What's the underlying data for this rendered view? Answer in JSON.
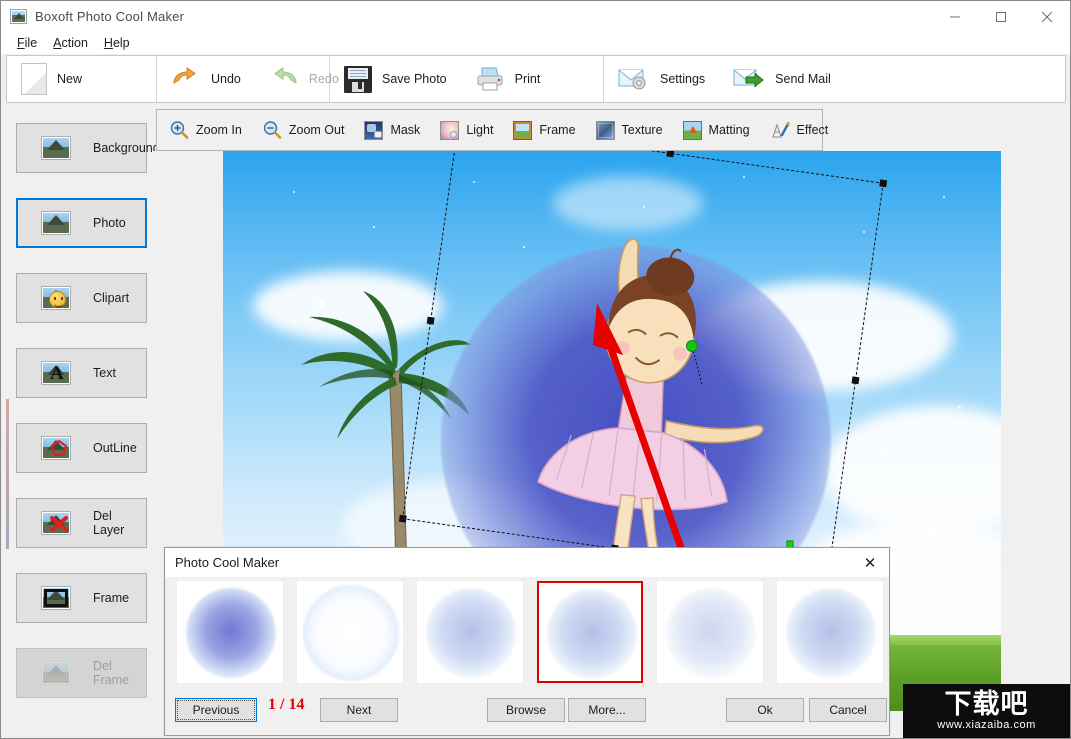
{
  "window": {
    "title": "Boxoft Photo Cool Maker",
    "icon": "app-photo-icon",
    "controls": {
      "minimize": "—",
      "maximize": "□",
      "close": "✕"
    }
  },
  "menubar": {
    "items": [
      {
        "label": "File",
        "mnemonic": "F"
      },
      {
        "label": "Action",
        "mnemonic": "A"
      },
      {
        "label": "Help",
        "mnemonic": "H"
      }
    ]
  },
  "toolbar": {
    "groups": [
      {
        "items": [
          {
            "label": "New",
            "icon": "new-page-icon",
            "enabled": true
          }
        ]
      },
      {
        "items": [
          {
            "label": "Undo",
            "icon": "undo-arrow-icon",
            "enabled": true
          },
          {
            "label": "Redo",
            "icon": "redo-arrow-icon",
            "enabled": false
          }
        ]
      },
      {
        "items": [
          {
            "label": "Save Photo",
            "icon": "floppy-disk-icon",
            "enabled": true
          },
          {
            "label": "Print",
            "icon": "printer-icon",
            "enabled": true
          }
        ]
      },
      {
        "items": [
          {
            "label": "Settings",
            "icon": "mail-gear-icon",
            "enabled": true
          },
          {
            "label": "Send Mail",
            "icon": "mail-send-icon",
            "enabled": true
          }
        ]
      }
    ]
  },
  "subtoolbar": {
    "items": [
      {
        "label": "Zoom In",
        "icon": "magnifier-plus-icon"
      },
      {
        "label": "Zoom Out",
        "icon": "magnifier-minus-icon"
      },
      {
        "label": "Mask",
        "icon": "mask-icon"
      },
      {
        "label": "Light",
        "icon": "light-icon"
      },
      {
        "label": "Frame",
        "icon": "frame-icon"
      },
      {
        "label": "Texture",
        "icon": "texture-icon"
      },
      {
        "label": "Matting",
        "icon": "matting-icon"
      },
      {
        "label": "Effect",
        "icon": "brush-effect-icon"
      }
    ]
  },
  "sidebar": {
    "items": [
      {
        "label": "Background",
        "icon": "landscape-icon",
        "selected": false,
        "enabled": true
      },
      {
        "label": "Photo",
        "icon": "landscape-icon",
        "selected": true,
        "enabled": true
      },
      {
        "label": "Clipart",
        "icon": "smiley-icon",
        "selected": false,
        "enabled": true
      },
      {
        "label": "Text",
        "icon": "letter-a-icon",
        "selected": false,
        "enabled": true
      },
      {
        "label": "OutLine",
        "icon": "outline-polygon-icon",
        "selected": false,
        "enabled": true
      },
      {
        "label": "Del Layer",
        "icon": "delete-layer-icon",
        "selected": false,
        "enabled": true
      },
      {
        "label": "Frame",
        "icon": "picture-frame-icon",
        "selected": false,
        "enabled": true
      },
      {
        "label": "Del Frame",
        "icon": "delete-frame-icon",
        "selected": false,
        "enabled": false
      }
    ]
  },
  "canvas": {
    "description": "sky-background-with-palm-tree-and-ballerina-photo-layer",
    "selection": {
      "rotate_handle": "green-rotate-handle",
      "move_handle": "green-move-cross",
      "annotation": "red-arrow"
    }
  },
  "dialog": {
    "title": "Photo Cool Maker",
    "close_label": "✕",
    "thumbnails": [
      {
        "name": "mask-thumb-1",
        "style": "deep-blue-halo",
        "selected": false
      },
      {
        "name": "mask-thumb-2",
        "style": "white-soft-circle",
        "selected": false
      },
      {
        "name": "mask-thumb-3",
        "style": "blue-halo",
        "selected": false
      },
      {
        "name": "mask-thumb-4",
        "style": "blue-halo",
        "selected": true
      },
      {
        "name": "mask-thumb-5",
        "style": "light-blue-halo",
        "selected": false
      },
      {
        "name": "mask-thumb-6",
        "style": "blue-halo",
        "selected": false
      }
    ],
    "buttons": {
      "previous": "Previous",
      "next": "Next",
      "browse": "Browse",
      "more": "More...",
      "ok": "Ok",
      "cancel": "Cancel"
    },
    "page_current": "1",
    "page_separator": "/",
    "page_total": "14",
    "page_counter": "1  /  14",
    "counter_color": "#e80000",
    "focused_button": "Previous"
  },
  "watermark": {
    "chinese": "下载吧",
    "url": "www.xiazaiba.com"
  },
  "colors": {
    "accent": "#0078d7",
    "selection_red": "#e00000",
    "counter_red": "#e80000",
    "chrome": "#f0f0f0",
    "button_face": "#e1e1e1"
  }
}
